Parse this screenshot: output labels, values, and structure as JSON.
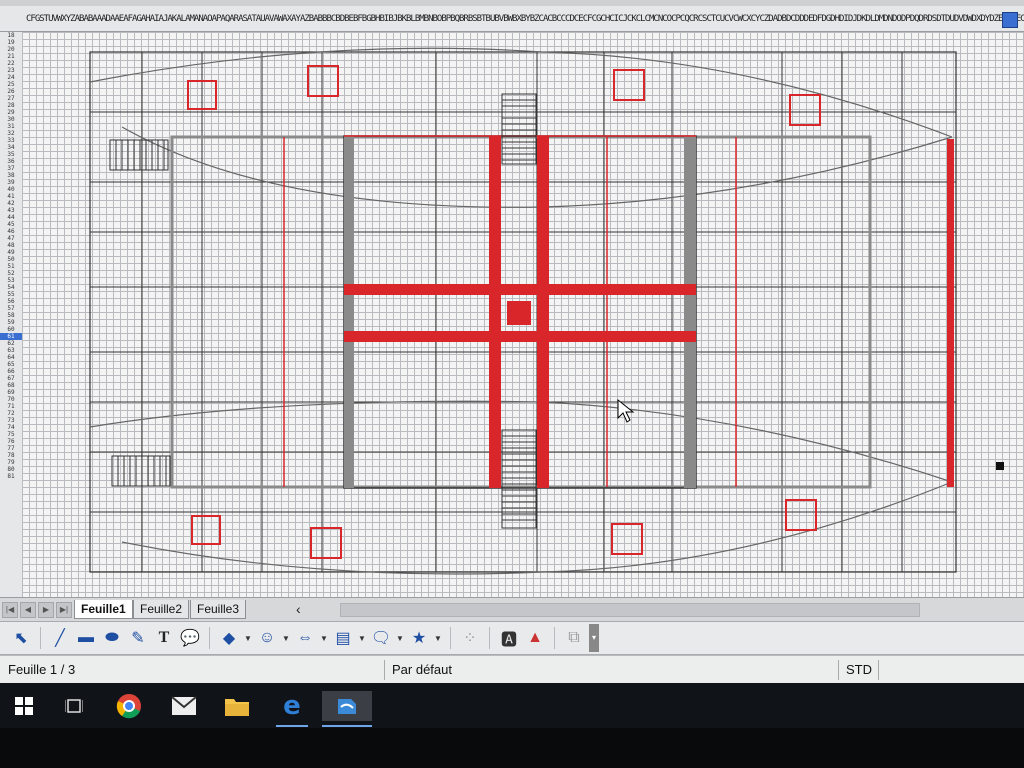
{
  "column_header": {
    "text": "CFGSTUVWXYZABABAAADAAEAFAGAHAIAJAKALAMANAOAPAQARASATAUAVAWAXAYAZBABBBCBDBEBFBGBHBIBJBKBLBMBNBOBPBQBRBSBTBUBVBWBXBYBZCACBCCCDCECFCGCHCICJCKCLCMCNCOCPCQCRCSCTCUCVCWCXCYCZDADBDCDDDEDFDGDHDIDJDKDLDMDNDODPDQDRDSDTDUDVDWDXDYDZEAEBECEDEEEFEGEHEIEJEKELEMENEOEPEQERESETEUEVEWEXEYEZFAFBFCFDFE"
  },
  "row_numbers": [
    "18",
    "19",
    "20",
    "21",
    "22",
    "23",
    "24",
    "25",
    "26",
    "27",
    "28",
    "29",
    "30",
    "31",
    "32",
    "33",
    "34",
    "35",
    "36",
    "37",
    "38",
    "39",
    "40",
    "41",
    "42",
    "43",
    "44",
    "45",
    "46",
    "47",
    "48",
    "49",
    "50",
    "51",
    "52",
    "53",
    "54",
    "55",
    "56",
    "57",
    "58",
    "59",
    "60",
    "61",
    "62",
    "63",
    "64",
    "65",
    "66",
    "67",
    "68",
    "69",
    "70",
    "71",
    "72",
    "73",
    "74",
    "75",
    "76",
    "77",
    "78",
    "79",
    "80",
    "81"
  ],
  "highlight_row": "61",
  "sheet_tabs": [
    {
      "label": "Feuille1",
      "active": true
    },
    {
      "label": "Feuille2",
      "active": false
    },
    {
      "label": "Feuille3",
      "active": false
    }
  ],
  "toolbar": {
    "items": [
      "select-icon",
      "line-icon",
      "rectangle-icon",
      "ellipse-icon",
      "pencil-icon",
      "text-icon",
      "callout-icon",
      "diamond-icon",
      "smiley-icon",
      "double-arrow-icon",
      "flowchart-icon",
      "speech-bubble-icon",
      "star-icon",
      "points-icon",
      "fontwork-icon",
      "insert-image-icon",
      "extrusion-icon"
    ]
  },
  "status": {
    "sheet": "Feuille 1 / 3",
    "style": "Par défaut",
    "mode": "STD"
  },
  "taskbar": {
    "items": [
      "windows-start-icon",
      "task-view-icon",
      "chrome-icon",
      "mail-icon",
      "file-explorer-icon",
      "edge-icon",
      "libreoffice-icon"
    ]
  },
  "colors": {
    "accent_red": "#d9262a",
    "grey_column": "#8a8a8a",
    "selection_blue": "#3a6fd1"
  }
}
